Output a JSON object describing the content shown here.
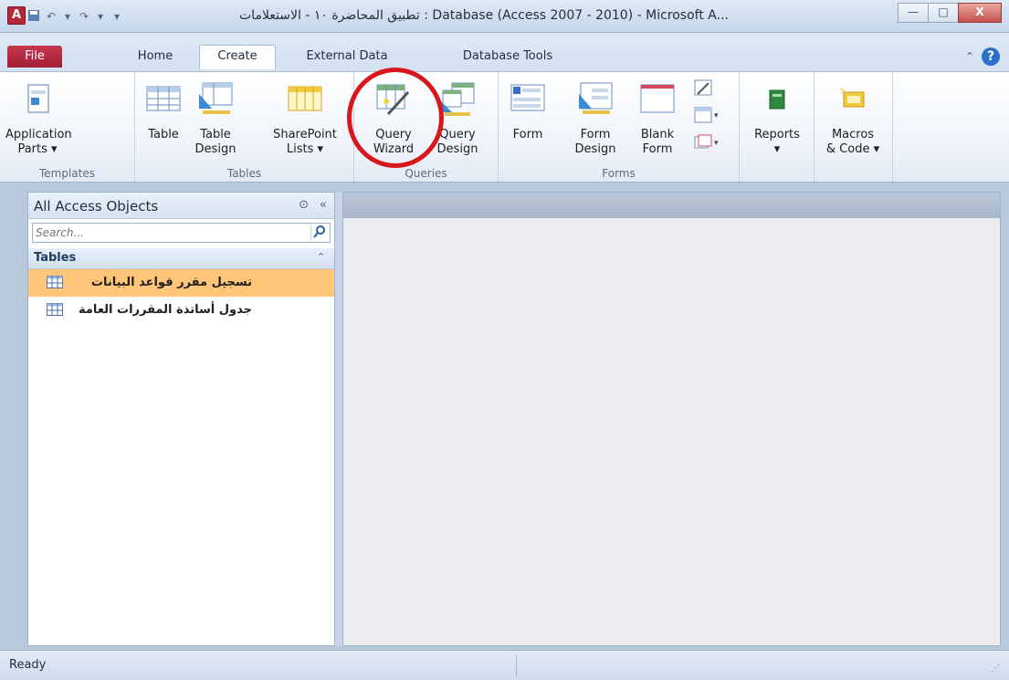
{
  "window": {
    "app_icon": "A",
    "title": "تطبيق المحاضرة ١٠ - الاستعلامات : Database (Access 2007 - 2010)  -  Microsoft A...",
    "qat": [
      "save-icon",
      "undo-icon",
      "redo-icon",
      "customize-icon"
    ],
    "buttons": {
      "minimize": "—",
      "maximize": "□",
      "close": "X"
    }
  },
  "tabs": [
    "File",
    "Home",
    "Create",
    "External Data",
    "Database Tools"
  ],
  "active_tab": "Create",
  "ribbon": {
    "groups": [
      {
        "label": "Templates",
        "buttons": [
          {
            "line1": "Application",
            "line2": "Parts ▾"
          }
        ]
      },
      {
        "label": "Tables",
        "buttons": [
          {
            "line1": "Table",
            "line2": ""
          },
          {
            "line1": "Table",
            "line2": "Design"
          },
          {
            "line1": "SharePoint",
            "line2": "Lists ▾"
          }
        ]
      },
      {
        "label": "Queries",
        "buttons": [
          {
            "line1": "Query",
            "line2": "Wizard"
          },
          {
            "line1": "Query",
            "line2": "Design"
          }
        ]
      },
      {
        "label": "Forms",
        "buttons": [
          {
            "line1": "Form",
            "line2": ""
          },
          {
            "line1": "Form",
            "line2": "Design"
          },
          {
            "line1": "Blank",
            "line2": "Form"
          }
        ]
      },
      {
        "label": "",
        "buttons": [
          {
            "line1": "Reports",
            "line2": "▾"
          }
        ]
      },
      {
        "label": "",
        "buttons": [
          {
            "line1": "Macros",
            "line2": "& Code ▾"
          }
        ]
      }
    ]
  },
  "nav": {
    "title": "All Access Objects",
    "search_placeholder": "Search...",
    "group": "Tables",
    "items": [
      {
        "label": "تسجيل مقرر قواعد البيانات",
        "selected": true
      },
      {
        "label": "جدول أساتذة المقررات العامة",
        "selected": false
      }
    ]
  },
  "status": {
    "text": "Ready"
  },
  "colors": {
    "file_tab": "#b3283a",
    "selected_item": "#ffc67a",
    "highlight_ring": "#d9161c"
  }
}
